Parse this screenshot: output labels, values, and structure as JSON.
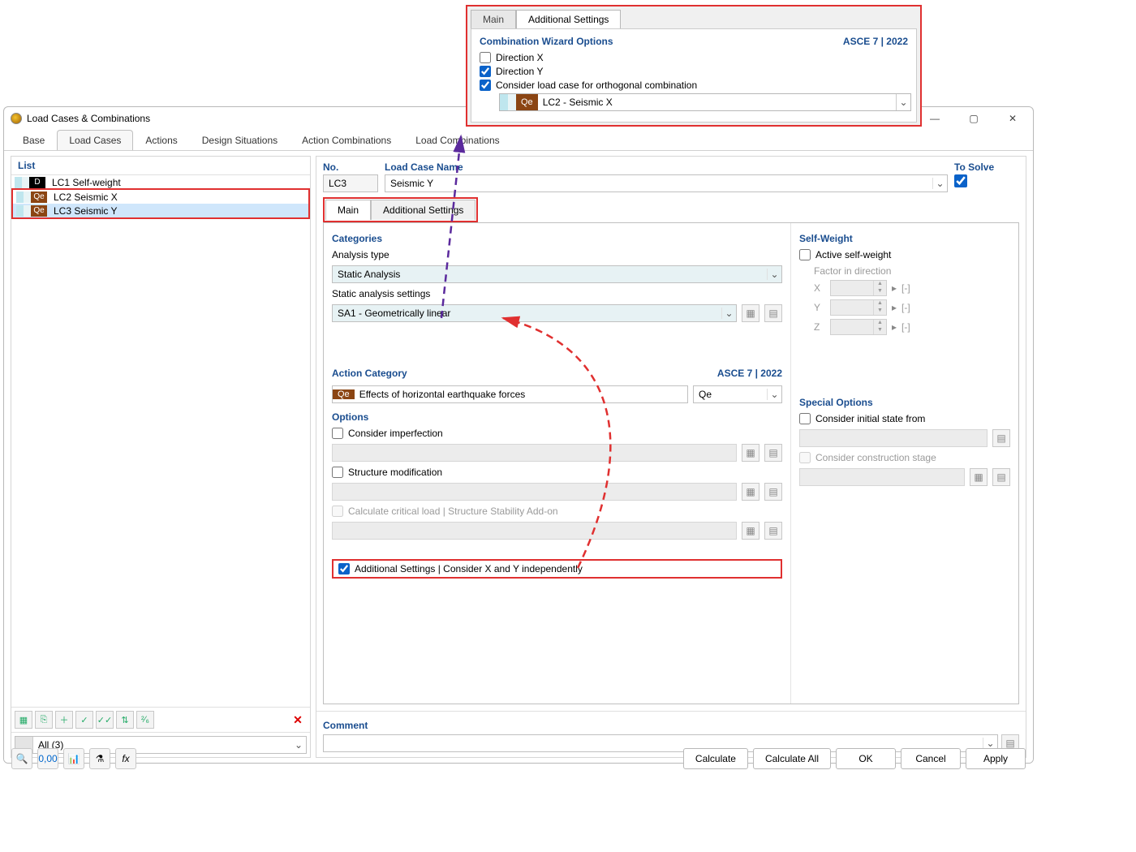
{
  "popup": {
    "tabs": {
      "main": "Main",
      "addl": "Additional Settings"
    },
    "heading": "Combination Wizard Options",
    "standard": "ASCE 7 | 2022",
    "dirx": "Direction X",
    "diry": "Direction Y",
    "orth": "Consider load case for orthogonal combination",
    "orth_badge": "Qe",
    "orth_val": "LC2 - Seismic X"
  },
  "window": {
    "title": "Load Cases & Combinations",
    "tabs": [
      "Base",
      "Load Cases",
      "Actions",
      "Design Situations",
      "Action Combinations",
      "Load Combinations"
    ],
    "list_head": "List",
    "rows": [
      {
        "badge": "D",
        "text": "LC1  Self-weight"
      },
      {
        "badge": "Qe",
        "text": "LC2  Seismic X"
      },
      {
        "badge": "Qe",
        "text": "LC3  Seismic Y"
      }
    ],
    "filter": "All (3)",
    "no_lbl": "No.",
    "no_val": "LC3",
    "name_lbl": "Load Case Name",
    "name_val": "Seismic Y",
    "solve_lbl": "To Solve",
    "rtabs": {
      "main": "Main",
      "addl": "Additional Settings"
    },
    "categories": "Categories",
    "analysis_type_lbl": "Analysis type",
    "analysis_type_val": "Static Analysis",
    "sas_lbl": "Static analysis settings",
    "sas_val": "SA1 - Geometrically linear",
    "ac_head": "Action Category",
    "ac_std": "ASCE 7 | 2022",
    "ac_badge": "Qe",
    "ac_text": "Effects of horizontal earthquake forces",
    "ac_code": "Qe",
    "opts": "Options",
    "opt_imp": "Consider imperfection",
    "opt_struct": "Structure modification",
    "opt_crit": "Calculate critical load | Structure Stability Add-on",
    "opt_addl": "Additional Settings | Consider X and Y independently",
    "sw_head": "Self-Weight",
    "sw_active": "Active self-weight",
    "sw_factorlbl": "Factor in direction",
    "axes": [
      "X",
      "Y",
      "Z"
    ],
    "unit": "[-]",
    "sp_head": "Special Options",
    "sp_init": "Consider initial state from",
    "sp_cons": "Consider construction stage",
    "comment": "Comment"
  },
  "footer": {
    "calc": "Calculate",
    "calcall": "Calculate All",
    "ok": "OK",
    "cancel": "Cancel",
    "apply": "Apply"
  }
}
